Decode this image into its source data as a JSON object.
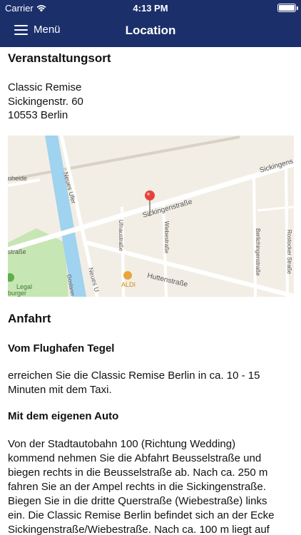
{
  "status_bar": {
    "carrier": "Carrier",
    "time": "4:13 PM"
  },
  "nav": {
    "menu_label": "Menü",
    "title": "Location"
  },
  "venue": {
    "heading": "Veranstaltungsort",
    "lines": [
      "Classic Remise",
      "Sickingenstr. 60",
      "10553 Berlin"
    ]
  },
  "map": {
    "streets": {
      "sickingenstrasse": "Sickingenstraße",
      "sickingenstrasse_right": "Sickingens",
      "neues_ufer": "Neues Ufer",
      "neues_ufer_lower": "Neues U",
      "ufnaustrasse": "Ufnaustraße",
      "wiebestrasse": "Wiebestraße",
      "huttenstrasse": "Huttenstraße",
      "berlichingenstrasse": "Berlichingenstraße",
      "rostocker": "Rostocker Straße",
      "nheide": "nheide",
      "strasse_left": "straße",
      "goslarer": "Goslarer"
    },
    "pois": {
      "aldi": "ALDI",
      "legal": "Legal",
      "burger": "burger"
    },
    "colors": {
      "water": "#9fd3ef",
      "park": "#c6e6b4",
      "road": "#ffffff",
      "pin": "#e8413b",
      "aldi": "#e8a53b",
      "bg": "#f3eee5"
    }
  },
  "anfahrt": {
    "heading": "Anfahrt",
    "sections": [
      {
        "title": "Vom Flughafen Tegel",
        "lines": [
          "erreichen Sie die Classic Remise Berlin in ca. 10 - 15",
          "Minuten mit dem Taxi."
        ]
      },
      {
        "title": "Mit dem eigenen Auto",
        "lines": [
          "Von der Stadtautobahn 100 (Richtung Wedding)",
          "kommend nehmen Sie die Abfahrt Beusselstraße und",
          "biegen rechts in die Beusselstraße ab. Nach ca. 250 m",
          "fahren Sie an der Ampel rechts in die Sickingenstraße.",
          "Biegen Sie in die dritte Querstraße (Wiebestraße) links",
          "ein. Die Classic Remise Berlin befindet sich an der Ecke",
          "Sickingenstraße/Wiebestraße. Nach ca. 100 m liegt auf"
        ]
      }
    ]
  }
}
